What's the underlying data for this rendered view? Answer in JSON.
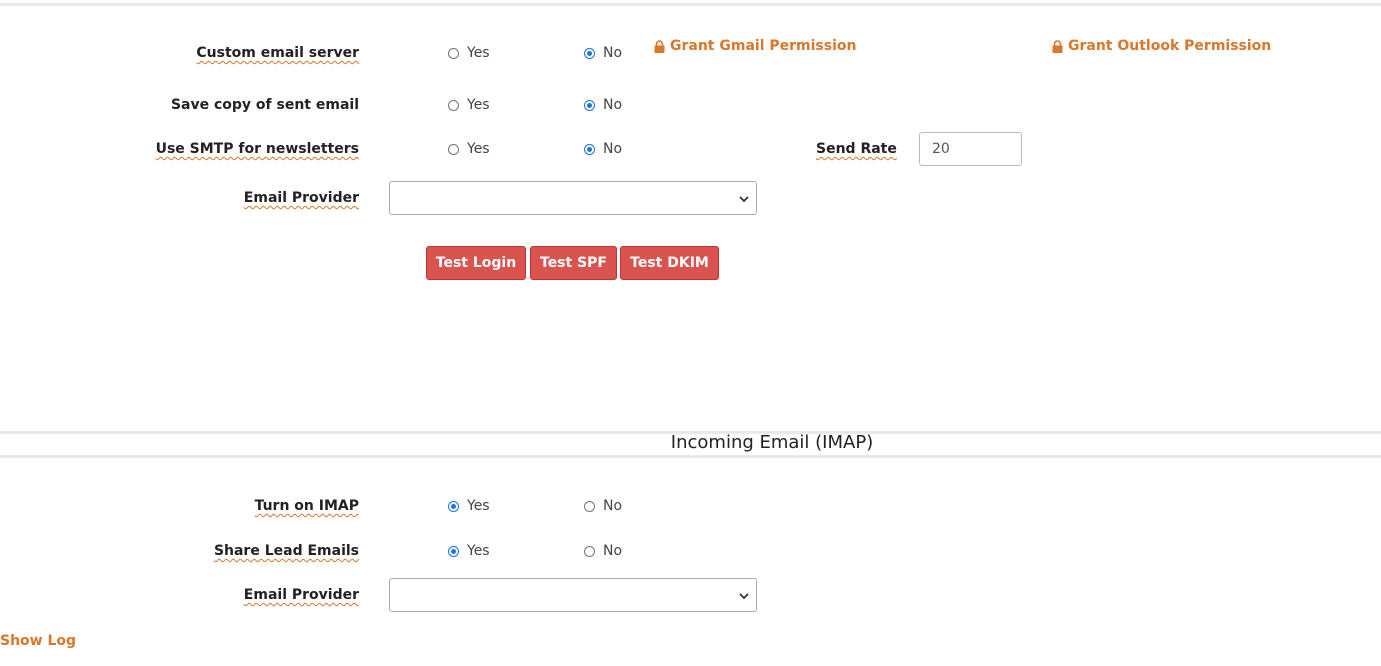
{
  "outgoing": {
    "links": {
      "gmail": "Grant Gmail Permission",
      "outlook": "Grant Outlook Permission"
    },
    "rows": {
      "custom_server": {
        "label": "Custom email server",
        "yes": "Yes",
        "no": "No",
        "selected": "No"
      },
      "save_copy": {
        "label": "Save copy of sent email",
        "yes": "Yes",
        "no": "No",
        "selected": "No"
      },
      "smtp_newsletters": {
        "label": "Use SMTP for newsletters",
        "yes": "Yes",
        "no": "No",
        "selected": "No"
      }
    },
    "send_rate": {
      "label": "Send Rate",
      "value": "20"
    },
    "email_provider": {
      "label": "Email Provider",
      "value": ""
    },
    "buttons": {
      "test_login": "Test Login",
      "test_spf": "Test SPF",
      "test_dkim": "Test DKIM"
    }
  },
  "incoming": {
    "title": "Incoming Email (IMAP)",
    "rows": {
      "turn_on_imap": {
        "label": "Turn on IMAP",
        "yes": "Yes",
        "no": "No",
        "selected": "Yes"
      },
      "share_lead": {
        "label": "Share Lead Emails",
        "yes": "Yes",
        "no": "No",
        "selected": "Yes"
      }
    },
    "email_provider": {
      "label": "Email Provider",
      "value": ""
    }
  },
  "footer": {
    "show_log": "Show Log"
  },
  "colors": {
    "accent": "#d9772a",
    "button": "#d9534f",
    "radio": "#1a73e8"
  }
}
